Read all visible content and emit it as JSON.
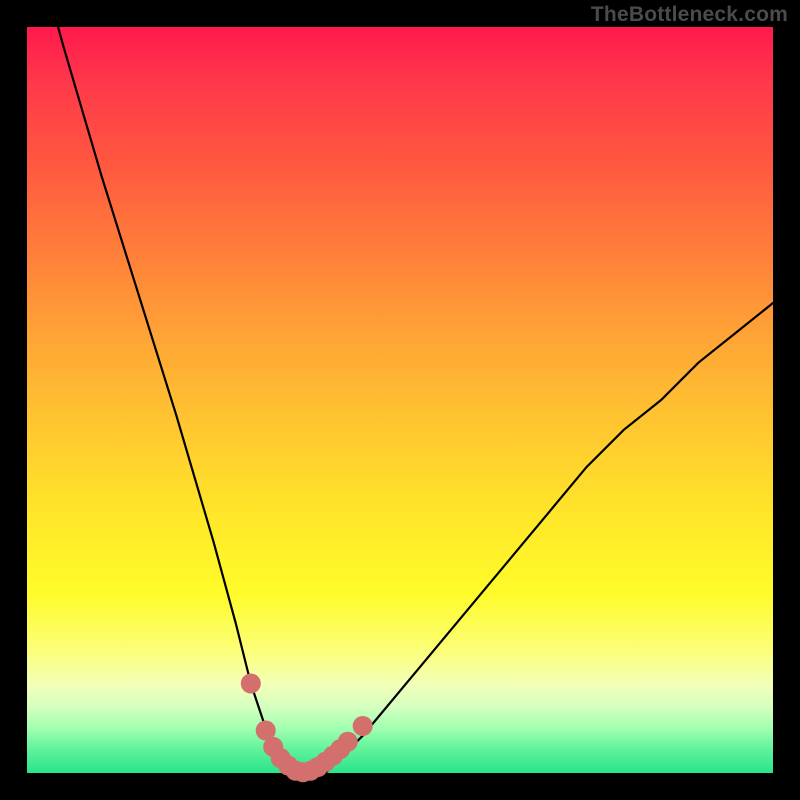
{
  "watermark": "TheBottleneck.com",
  "chart_data": {
    "type": "line",
    "title": "",
    "xlabel": "",
    "ylabel": "",
    "xlim": [
      0,
      100
    ],
    "ylim": [
      0,
      100
    ],
    "series": [
      {
        "name": "bottleneck-curve",
        "x": [
          0,
          5,
          10,
          15,
          20,
          25,
          28,
          30,
          32,
          34,
          36,
          38,
          40,
          42,
          45,
          50,
          55,
          60,
          65,
          70,
          75,
          80,
          85,
          90,
          95,
          100
        ],
        "values": [
          115,
          97,
          80,
          64,
          48,
          31,
          20,
          12,
          6,
          2,
          0,
          0,
          0,
          2,
          5,
          11,
          17,
          23,
          29,
          35,
          41,
          46,
          50,
          55,
          59,
          63
        ]
      }
    ],
    "markers": {
      "name": "highlight-dots",
      "color": "#d3706e",
      "x": [
        30,
        32,
        33,
        34,
        35,
        36,
        37,
        38,
        39,
        40,
        41,
        42,
        43,
        45
      ],
      "values": [
        12.0,
        5.7,
        3.5,
        2.0,
        1.0,
        0.3,
        0.1,
        0.3,
        0.8,
        1.5,
        2.3,
        3.2,
        4.2,
        6.3
      ]
    },
    "background_gradient": {
      "top": "#ff1a4d",
      "mid": "#ffe829",
      "bottom": "#29e48b"
    }
  }
}
